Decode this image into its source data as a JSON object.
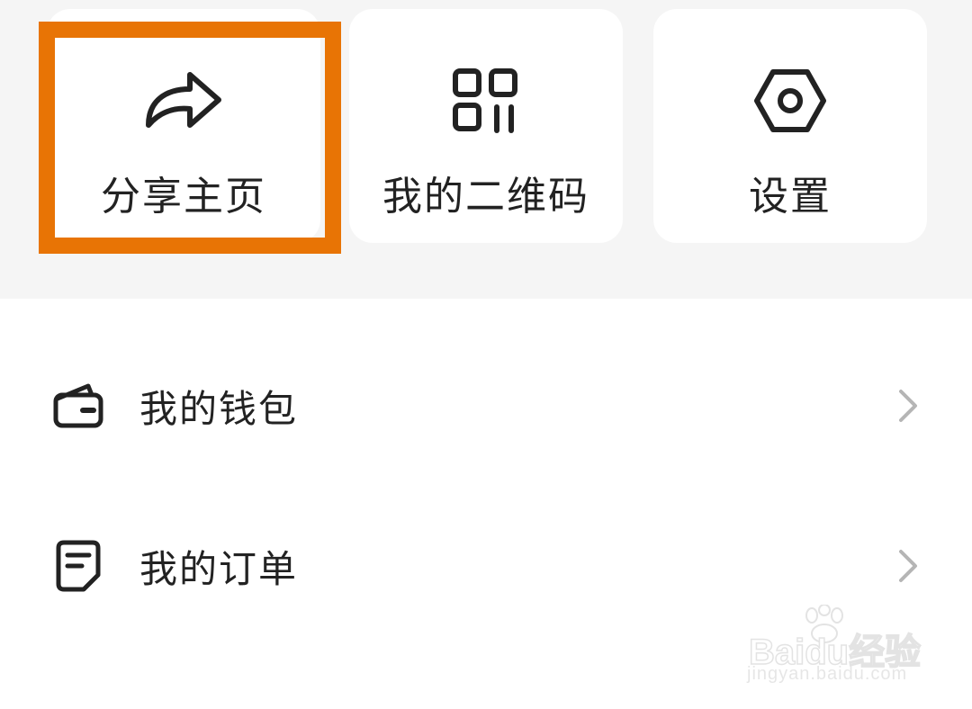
{
  "shortcuts": [
    {
      "label": "分享主页",
      "icon": "share-arrow-icon"
    },
    {
      "label": "我的二维码",
      "icon": "qr-code-icon"
    },
    {
      "label": "设置",
      "icon": "settings-hexagon-icon"
    }
  ],
  "menu": [
    {
      "label": "我的钱包",
      "icon": "wallet-icon"
    },
    {
      "label": "我的订单",
      "icon": "order-document-icon"
    }
  ],
  "highlight": {
    "target": "分享主页",
    "color": "#e87405"
  },
  "watermark": {
    "brand": "Baidu经验",
    "url": "jingyan.baidu.com"
  }
}
